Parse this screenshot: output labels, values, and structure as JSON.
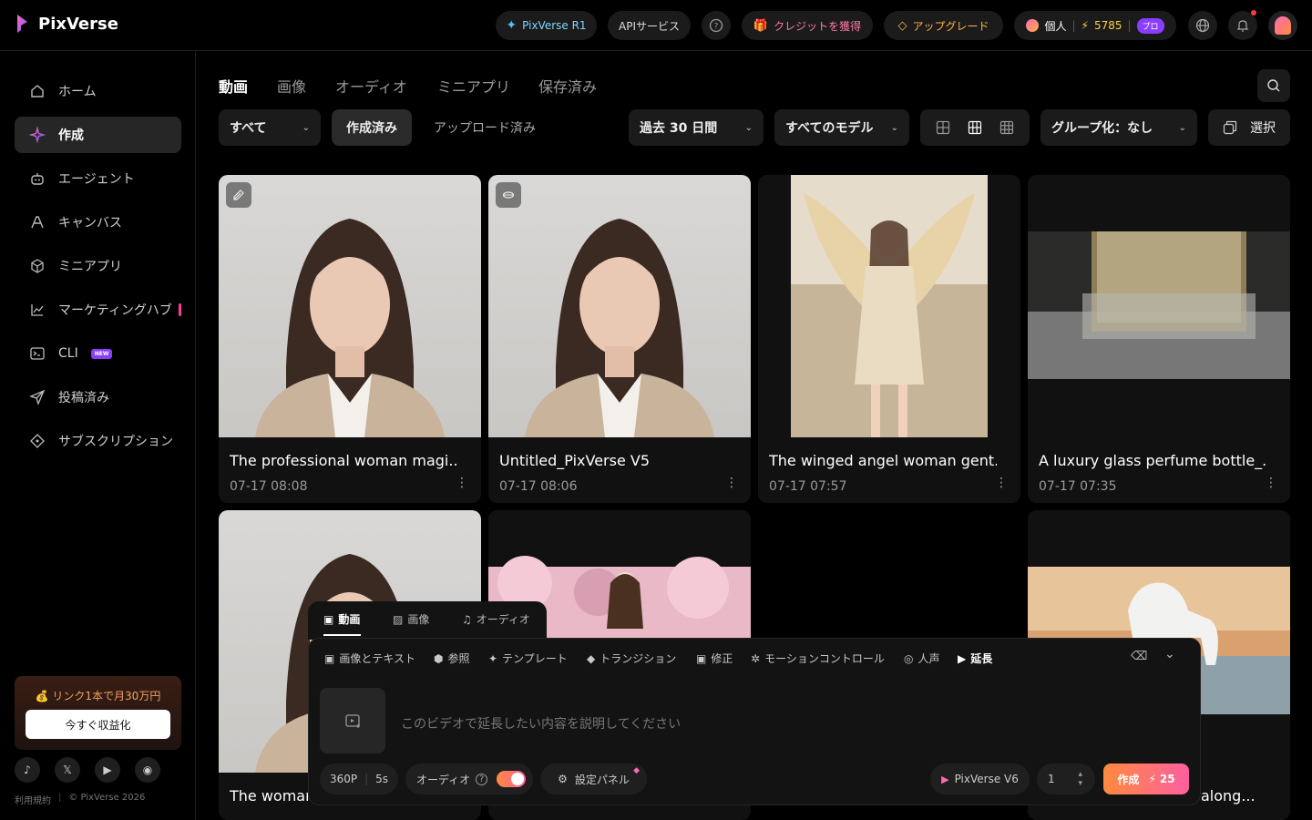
{
  "topbar": {
    "logo": "PixVerse",
    "r1_label": "PixVerse R1",
    "api_label": "APIサービス",
    "credits_label": "クレジットを獲得",
    "upgrade_label": "アップグレード",
    "account_type": "個人",
    "credits_count": "5785",
    "plan_badge": "プロ"
  },
  "sidebar": {
    "items": [
      {
        "label": "ホーム",
        "icon": "home-icon"
      },
      {
        "label": "作成",
        "icon": "sparkle-icon",
        "active": true
      },
      {
        "label": "エージェント",
        "icon": "robot-icon"
      },
      {
        "label": "キャンバス",
        "icon": "canvas-icon"
      },
      {
        "label": "ミニアプリ",
        "icon": "cube-icon"
      },
      {
        "label": "マーケティングハブ",
        "icon": "chart-icon"
      },
      {
        "label": "CLI",
        "icon": "terminal-icon",
        "badge": "NEW"
      },
      {
        "label": "投稿済み",
        "icon": "send-icon"
      },
      {
        "label": "サブスクリプション",
        "icon": "diamond-icon"
      }
    ],
    "promo_text": "💰 リンク1本で月30万円",
    "promo_button": "今すぐ収益化",
    "footer_terms": "利用規約",
    "footer_copyright": "© PixVerse 2026"
  },
  "tabs": [
    "動画",
    "画像",
    "オーディオ",
    "ミニアプリ",
    "保存済み"
  ],
  "filters": {
    "type": "すべて",
    "created": "作成済み",
    "uploaded": "アップロード済み",
    "period": "過去 30 日間",
    "model": "すべてのモデル",
    "group": "グループ化：なし",
    "select": "選択"
  },
  "cards": [
    {
      "title": "The professional woman magi...",
      "date": "07-17  08:08"
    },
    {
      "title": "Untitled_PixVerse V5",
      "date": "07-17  08:06"
    },
    {
      "title": "The winged angel woman gent...",
      "date": "07-17  07:57"
    },
    {
      "title": "A luxury glass perfume bottle_...",
      "date": "07-17  07:35"
    },
    {
      "title": "The woman",
      "date": ""
    },
    {
      "title": "",
      "date": ""
    },
    {
      "title": "",
      "date": ""
    },
    {
      "title": "along...",
      "date": ""
    }
  ],
  "composer": {
    "tabs": [
      "動画",
      "画像",
      "オーディオ"
    ],
    "modes": [
      "画像とテキスト",
      "参照",
      "テンプレート",
      "トランジション",
      "修正",
      "モーションコントロール",
      "人声",
      "延長"
    ],
    "placeholder": "このビデオで延長したい内容を説明してください",
    "resolution": "360P",
    "duration": "5s",
    "audio_label": "オーディオ",
    "settings_label": "設定パネル",
    "model": "PixVerse V6",
    "count": "1",
    "create_label": "作成",
    "cost": "25"
  },
  "colors": {
    "accent_pink": "#f26a8d",
    "accent_orange": "#ff8a3d",
    "toggle_gradient": "#ff5fa0"
  }
}
